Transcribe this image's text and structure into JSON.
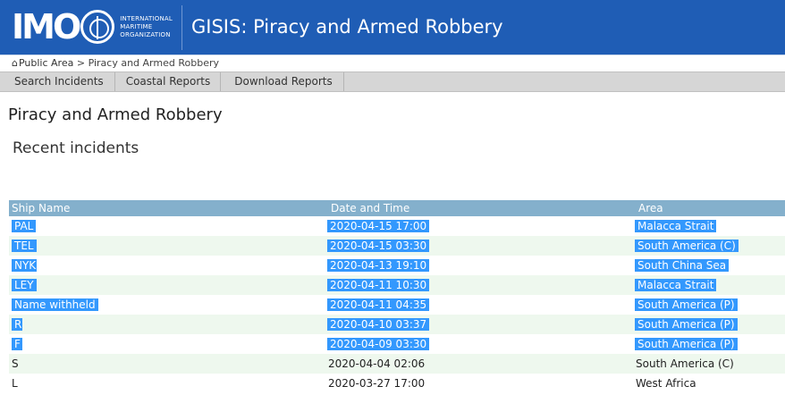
{
  "header": {
    "logo_letters": "IMO",
    "logo_words": [
      "INTERNATIONAL",
      "MARITIME",
      "ORGANIZATION"
    ],
    "app_title": "GISIS: Piracy and Armed Robbery",
    "colors": {
      "header_bg": "#1f5db5",
      "table_header_bg": "#84b0cc",
      "selection": "#3398fd",
      "alt_row": "#eef8ee"
    }
  },
  "breadcrumb": {
    "home_icon": "home-icon",
    "home": "Public Area",
    "separator": ">",
    "current": "Piracy and Armed Robbery"
  },
  "nav": {
    "items": [
      "Search Incidents",
      "Coastal Reports",
      "Download Reports"
    ]
  },
  "page": {
    "title": "Piracy and Armed Robbery",
    "section": "Recent incidents"
  },
  "table": {
    "headers": [
      "Ship Name",
      "Date and Time",
      "Area"
    ],
    "rows": [
      {
        "ship": "PAL",
        "datetime": "2020-04-15 17:00",
        "area": "Malacca Strait",
        "selected": true
      },
      {
        "ship": "TEL",
        "datetime": "2020-04-15 03:30",
        "area": "South America (C)",
        "selected": true
      },
      {
        "ship": "NYK",
        "datetime": "2020-04-13 19:10",
        "area": "South China Sea",
        "selected": true
      },
      {
        "ship": "LEY",
        "datetime": "2020-04-11 10:30",
        "area": "Malacca Strait",
        "selected": true
      },
      {
        "ship": "Name withheld",
        "datetime": "2020-04-11 04:35",
        "area": "South America (P)",
        "selected": true
      },
      {
        "ship": "R",
        "datetime": "2020-04-10 03:37",
        "area": "South America (P)",
        "selected": true
      },
      {
        "ship": "F",
        "datetime": "2020-04-09 03:30",
        "area": "South America (P)",
        "selected": true
      },
      {
        "ship": "S",
        "datetime": "2020-04-04 02:06",
        "area": "South America (C)",
        "selected": false
      },
      {
        "ship": "L",
        "datetime": "2020-03-27 17:00",
        "area": "West Africa",
        "selected": false
      }
    ]
  }
}
